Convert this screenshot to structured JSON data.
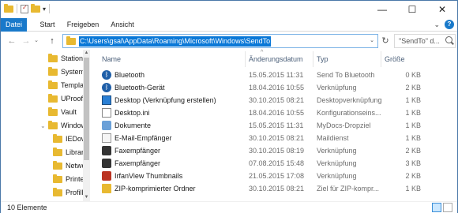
{
  "quick_access": {
    "dropdown_label": "▾"
  },
  "window_controls": {
    "minimize": "—",
    "maximize": "☐",
    "close": "✕"
  },
  "ribbon": {
    "tabs": [
      {
        "label": "Datei"
      },
      {
        "label": "Start"
      },
      {
        "label": "Freigeben"
      },
      {
        "label": "Ansicht"
      }
    ],
    "expand_label": "⌄",
    "help_label": "?"
  },
  "navigation": {
    "back": "←",
    "forward": "→",
    "recent": "⌄",
    "up": "↑"
  },
  "address": {
    "path": "C:\\Users\\gsal\\AppData\\Roaming\\Microsoft\\Windows\\SendTo",
    "dropdown": "⌄",
    "refresh": "↻"
  },
  "search": {
    "placeholder": "\"SendTo\" d..."
  },
  "nav_pane": {
    "items": [
      {
        "label": "Station"
      },
      {
        "label": "System"
      },
      {
        "label": "Templa"
      },
      {
        "label": "UProof"
      },
      {
        "label": "Vault"
      },
      {
        "label": "Window"
      },
      {
        "label": "IEDow"
      },
      {
        "label": "Librar"
      },
      {
        "label": "Netwo"
      },
      {
        "label": "Printe"
      },
      {
        "label": "Profill"
      }
    ]
  },
  "columns": {
    "name": "Name",
    "date": "Änderungsdatum",
    "type": "Typ",
    "size": "Größe",
    "sort_indicator": "^"
  },
  "files": [
    {
      "name": "Bluetooth",
      "date": "15.05.2015 11:31",
      "type": "Send To Bluetooth",
      "size": "0 KB",
      "icon": "bluetooth-icon"
    },
    {
      "name": "Bluetooth-Gerät",
      "date": "18.04.2016 10:55",
      "type": "Verknüpfung",
      "size": "2 KB",
      "icon": "bluetooth-icon"
    },
    {
      "name": "Desktop (Verknüpfung erstellen)",
      "date": "30.10.2015 08:21",
      "type": "Desktopverknüpfung",
      "size": "1 KB",
      "icon": "desktop-icon"
    },
    {
      "name": "Desktop.ini",
      "date": "18.04.2016 10:55",
      "type": "Konfigurationseins...",
      "size": "1 KB",
      "icon": "ini-file-icon"
    },
    {
      "name": "Dokumente",
      "date": "15.05.2015 11:31",
      "type": "MyDocs-Dropziel",
      "size": "1 KB",
      "icon": "documents-icon"
    },
    {
      "name": "E-Mail-Empfänger",
      "date": "30.10.2015 08:21",
      "type": "Maildienst",
      "size": "1 KB",
      "icon": "mail-icon"
    },
    {
      "name": "Faxempfänger",
      "date": "30.10.2015 08:19",
      "type": "Verknüpfung",
      "size": "2 KB",
      "icon": "fax-icon"
    },
    {
      "name": "Faxempfänger",
      "date": "07.08.2015 15:48",
      "type": "Verknüpfung",
      "size": "3 KB",
      "icon": "fax-icon"
    },
    {
      "name": "IrfanView Thumbnails",
      "date": "21.05.2015 17:08",
      "type": "Verknüpfung",
      "size": "2 KB",
      "icon": "irfanview-icon"
    },
    {
      "name": "ZIP-komprimierter Ordner",
      "date": "30.10.2015 08:21",
      "type": "Ziel für ZIP-kompr...",
      "size": "1 KB",
      "icon": "zip-folder-icon"
    }
  ],
  "status": {
    "item_count": "10 Elemente"
  },
  "colors": {
    "accent": "#1979ca",
    "selection": "#0a78d7",
    "folder": "#e8b931"
  }
}
